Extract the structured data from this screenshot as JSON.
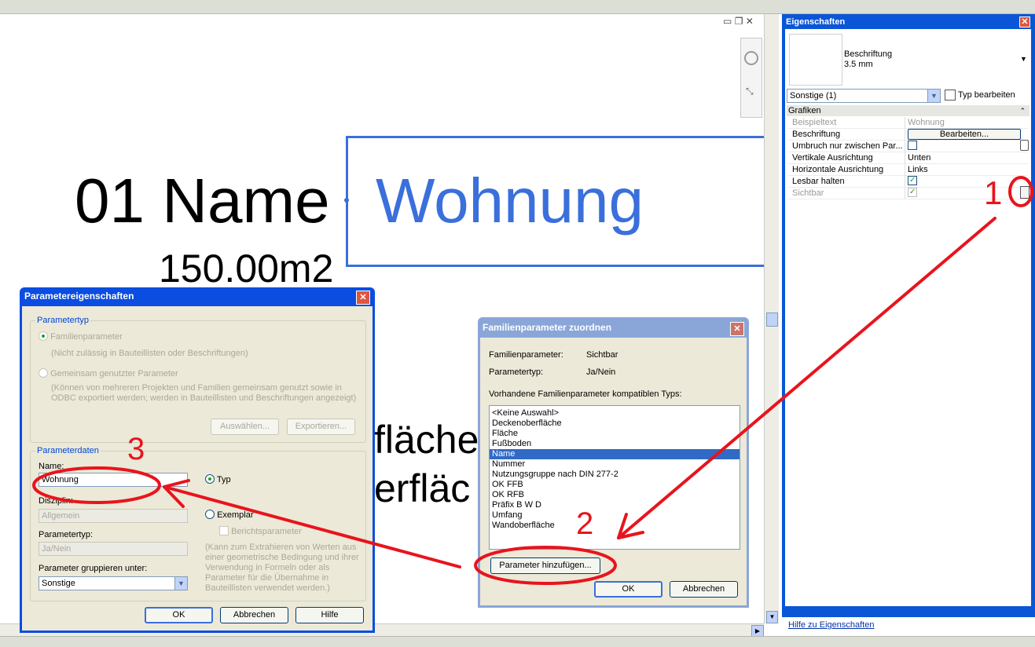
{
  "canvas": {
    "line1_prefix": "01 Name",
    "line1_value": "Wohnung",
    "line2": "150.00m2",
    "fragment_1": "fläche",
    "fragment_2": "erfläc"
  },
  "properties": {
    "title": "Eigenschaften",
    "type_name": "Beschriftung",
    "type_size": "3.5 mm",
    "selector": "Sonstige (1)",
    "edit_type": "Typ bearbeiten",
    "group": "Grafiken",
    "rows": [
      {
        "key": "Beispieltext",
        "value": "Wohnung"
      },
      {
        "key": "Beschriftung",
        "value": "Bearbeiten..."
      },
      {
        "key": "Umbruch nur zwischen Par...",
        "value": ""
      },
      {
        "key": "Vertikale Ausrichtung",
        "value": "Unten"
      },
      {
        "key": "Horizontale Ausrichtung",
        "value": "Links"
      },
      {
        "key": "Lesbar halten",
        "value": ""
      },
      {
        "key": "Sichtbar",
        "value": ""
      }
    ],
    "help_link": "Hilfe zu Eigenschaften"
  },
  "param_dialog": {
    "title": "Parametereigenschaften",
    "type_group": "Parametertyp",
    "family_param": "Familienparameter",
    "family_param_note": "(Nicht zulässig in Bauteillisten oder Beschriftungen)",
    "shared_param": "Gemeinsam genutzter Parameter",
    "shared_param_note": "(Können von mehreren Projekten und Familien gemeinsam genutzt sowie in ODBC exportiert werden; werden in Bauteillisten und Beschriftungen angezeigt)",
    "select_btn": "Auswählen...",
    "export_btn": "Exportieren...",
    "data_group": "Parameterdaten",
    "name_label": "Name:",
    "name_value": "Wohnung",
    "type_radio": "Typ",
    "discipline_label": "Disziplin:",
    "discipline_value": "Allgemein",
    "instance_radio": "Exemplar",
    "ptype_label": "Parametertyp:",
    "ptype_value": "Ja/Nein",
    "report_param": "Berichtsparameter",
    "report_note": "(Kann zum Extrahieren von Werten aus einer geometrische Bedingung und ihrer Verwendung in Formeln oder als Parameter für die Übernahme in Bauteillisten verwendet werden.)",
    "group_label": "Parameter gruppieren unter:",
    "group_value": "Sonstige",
    "ok": "OK",
    "cancel": "Abbrechen",
    "help": "Hilfe"
  },
  "family_dialog": {
    "title": "Familienparameter zuordnen",
    "fp_label": "Familienparameter:",
    "fp_value": "Sichtbar",
    "pt_label": "Parametertyp:",
    "pt_value": "Ja/Nein",
    "list_label": "Vorhandene Familienparameter kompatiblen Typs:",
    "items": [
      "<Keine Auswahl>",
      "Deckenoberfläche",
      "Fläche",
      "Fußboden",
      "Name",
      "Nummer",
      "Nutzungsgruppe nach DIN 277-2",
      "OK FFB",
      "OK RFB",
      "Präfix B W D",
      "Umfang",
      "Wandoberfläche"
    ],
    "add_btn": "Parameter hinzufügen...",
    "ok": "OK",
    "cancel": "Abbrechen"
  },
  "annotations": {
    "n1": "1",
    "n2": "2",
    "n3": "3"
  },
  "colors": {
    "accent": "#3a6fdc",
    "annotation": "#e8141d",
    "xp_title": "#0a4de0"
  }
}
